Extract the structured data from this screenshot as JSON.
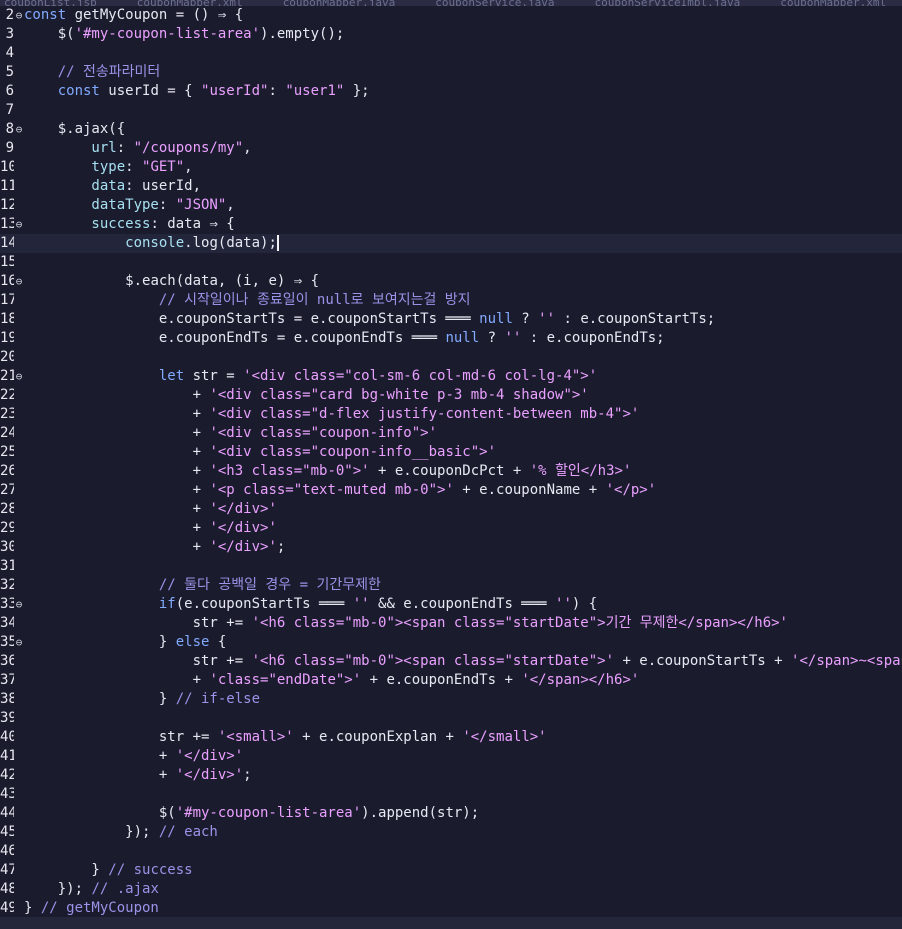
{
  "editor": {
    "tabs": [
      "couponList.jsp",
      "couponMapper.xml",
      "couponMapper.java",
      "couponService.java",
      "couponServiceImpl.java",
      "couponMapper.xml"
    ],
    "cursor_line": "14",
    "lines": [
      {
        "n": "2",
        "fold": "⊖",
        "tokens": [
          {
            "c": "kw",
            "t": "const "
          },
          {
            "c": "fn",
            "t": "getMyCoupon"
          },
          {
            "c": "op",
            "t": " = () ⇒ {"
          }
        ]
      },
      {
        "n": "3",
        "tokens": [
          {
            "c": "op",
            "t": "    $("
          },
          {
            "c": "str",
            "t": "'#my-coupon-list-area'"
          },
          {
            "c": "op",
            "t": ")."
          },
          {
            "c": "fn",
            "t": "empty"
          },
          {
            "c": "op",
            "t": "();"
          }
        ]
      },
      {
        "n": "4",
        "tokens": []
      },
      {
        "n": "5",
        "tokens": [
          {
            "c": "cmt",
            "t": "    // 전송파라미터"
          }
        ]
      },
      {
        "n": "6",
        "tokens": [
          {
            "c": "kw",
            "t": "    const "
          },
          {
            "c": "op",
            "t": "userId = { "
          },
          {
            "c": "str",
            "t": "\"userId\""
          },
          {
            "c": "op",
            "t": ": "
          },
          {
            "c": "str",
            "t": "\"user1\""
          },
          {
            "c": "op",
            "t": " };"
          }
        ]
      },
      {
        "n": "7",
        "tokens": []
      },
      {
        "n": "8",
        "fold": "⊖",
        "tokens": [
          {
            "c": "op",
            "t": "    $."
          },
          {
            "c": "fn",
            "t": "ajax"
          },
          {
            "c": "op",
            "t": "({"
          }
        ]
      },
      {
        "n": "9",
        "tokens": [
          {
            "c": "prop",
            "t": "        url"
          },
          {
            "c": "op",
            "t": ": "
          },
          {
            "c": "str",
            "t": "\"/coupons/my\""
          },
          {
            "c": "op",
            "t": ","
          }
        ]
      },
      {
        "n": "10",
        "tokens": [
          {
            "c": "prop",
            "t": "        type"
          },
          {
            "c": "op",
            "t": ": "
          },
          {
            "c": "str",
            "t": "\"GET\""
          },
          {
            "c": "op",
            "t": ","
          }
        ]
      },
      {
        "n": "11",
        "tokens": [
          {
            "c": "prop",
            "t": "        data"
          },
          {
            "c": "op",
            "t": ": userId,"
          }
        ]
      },
      {
        "n": "12",
        "tokens": [
          {
            "c": "prop",
            "t": "        dataType"
          },
          {
            "c": "op",
            "t": ": "
          },
          {
            "c": "str",
            "t": "\"JSON\""
          },
          {
            "c": "op",
            "t": ","
          }
        ]
      },
      {
        "n": "13",
        "fold": "⊖",
        "tokens": [
          {
            "c": "prop",
            "t": "        success"
          },
          {
            "c": "op",
            "t": ": data ⇒ {"
          }
        ]
      },
      {
        "n": "14",
        "current": true,
        "tokens": [
          {
            "c": "prop",
            "t": "            console"
          },
          {
            "c": "op",
            "t": "."
          },
          {
            "c": "fn",
            "t": "log"
          },
          {
            "c": "op",
            "t": "(data);"
          }
        ]
      },
      {
        "n": "15",
        "tokens": []
      },
      {
        "n": "16",
        "fold": "⊖",
        "tokens": [
          {
            "c": "op",
            "t": "            $."
          },
          {
            "c": "fn",
            "t": "each"
          },
          {
            "c": "op",
            "t": "(data, (i, e) ⇒ {"
          }
        ]
      },
      {
        "n": "17",
        "tokens": [
          {
            "c": "cmt",
            "t": "                // 시작일이나 종료일이 null로 보여지는걸 방지"
          }
        ]
      },
      {
        "n": "18",
        "tokens": [
          {
            "c": "op",
            "t": "                e.couponStartTs = e.couponStartTs ═══ "
          },
          {
            "c": "kw",
            "t": "null"
          },
          {
            "c": "op",
            "t": " ? "
          },
          {
            "c": "str",
            "t": "''"
          },
          {
            "c": "op",
            "t": " : e.couponStartTs;"
          }
        ]
      },
      {
        "n": "19",
        "tokens": [
          {
            "c": "op",
            "t": "                e.couponEndTs = e.couponEndTs ═══ "
          },
          {
            "c": "kw",
            "t": "null"
          },
          {
            "c": "op",
            "t": " ? "
          },
          {
            "c": "str",
            "t": "''"
          },
          {
            "c": "op",
            "t": " : e.couponEndTs;"
          }
        ]
      },
      {
        "n": "20",
        "tokens": []
      },
      {
        "n": "21",
        "fold": "⊖",
        "tokens": [
          {
            "c": "kw",
            "t": "                let "
          },
          {
            "c": "op",
            "t": "str = "
          },
          {
            "c": "str",
            "t": "'<div class=\"col-sm-6 col-md-6 col-lg-4\">'"
          }
        ]
      },
      {
        "n": "22",
        "tokens": [
          {
            "c": "op",
            "t": "                    + "
          },
          {
            "c": "str",
            "t": "'<div class=\"card bg-white p-3 mb-4 shadow\">'"
          }
        ]
      },
      {
        "n": "23",
        "tokens": [
          {
            "c": "op",
            "t": "                    + "
          },
          {
            "c": "str",
            "t": "'<div class=\"d-flex justify-content-between mb-4\">'"
          }
        ]
      },
      {
        "n": "24",
        "tokens": [
          {
            "c": "op",
            "t": "                    + "
          },
          {
            "c": "str",
            "t": "'<div class=\"coupon-info\">'"
          }
        ]
      },
      {
        "n": "25",
        "tokens": [
          {
            "c": "op",
            "t": "                    + "
          },
          {
            "c": "str",
            "t": "'<div class=\"coupon-info__basic\">'"
          }
        ]
      },
      {
        "n": "26",
        "tokens": [
          {
            "c": "op",
            "t": "                    + "
          },
          {
            "c": "str",
            "t": "'<h3 class=\"mb-0\">'"
          },
          {
            "c": "op",
            "t": " + e.couponDcPct + "
          },
          {
            "c": "str",
            "t": "'% 할인</h3>'"
          }
        ]
      },
      {
        "n": "27",
        "tokens": [
          {
            "c": "op",
            "t": "                    + "
          },
          {
            "c": "str",
            "t": "'<p class=\"text-muted mb-0\">'"
          },
          {
            "c": "op",
            "t": " + e.couponName + "
          },
          {
            "c": "str",
            "t": "'</p>'"
          }
        ]
      },
      {
        "n": "28",
        "tokens": [
          {
            "c": "op",
            "t": "                    + "
          },
          {
            "c": "str",
            "t": "'</div>'"
          }
        ]
      },
      {
        "n": "29",
        "tokens": [
          {
            "c": "op",
            "t": "                    + "
          },
          {
            "c": "str",
            "t": "'</div>'"
          }
        ]
      },
      {
        "n": "30",
        "tokens": [
          {
            "c": "op",
            "t": "                    + "
          },
          {
            "c": "str",
            "t": "'</div>'"
          },
          {
            "c": "op",
            "t": ";"
          }
        ]
      },
      {
        "n": "31",
        "tokens": []
      },
      {
        "n": "32",
        "tokens": [
          {
            "c": "cmt",
            "t": "                // 둘다 공백일 경우 = 기간무제한"
          }
        ]
      },
      {
        "n": "33",
        "fold": "⊖",
        "tokens": [
          {
            "c": "kw",
            "t": "                if"
          },
          {
            "c": "op",
            "t": "(e.couponStartTs ═══ "
          },
          {
            "c": "str",
            "t": "''"
          },
          {
            "c": "op",
            "t": " && e.couponEndTs ═══ "
          },
          {
            "c": "str",
            "t": "''"
          },
          {
            "c": "op",
            "t": ") {"
          }
        ]
      },
      {
        "n": "34",
        "tokens": [
          {
            "c": "op",
            "t": "                    str += "
          },
          {
            "c": "str",
            "t": "'<h6 class=\"mb-0\"><span class=\"startDate\">기간 무제한</span></h6>'"
          }
        ]
      },
      {
        "n": "35",
        "fold": "⊖",
        "tokens": [
          {
            "c": "op",
            "t": "                } "
          },
          {
            "c": "kw",
            "t": "else"
          },
          {
            "c": "op",
            "t": " {"
          }
        ]
      },
      {
        "n": "36",
        "tokens": [
          {
            "c": "op",
            "t": "                    str += "
          },
          {
            "c": "str",
            "t": "'<h6 class=\"mb-0\"><span class=\"startDate\">'"
          },
          {
            "c": "op",
            "t": " + e.couponStartTs + "
          },
          {
            "c": "str",
            "t": "'</span>~<span'"
          }
        ]
      },
      {
        "n": "37",
        "tokens": [
          {
            "c": "op",
            "t": "                    + "
          },
          {
            "c": "str",
            "t": "'class=\"endDate\">'"
          },
          {
            "c": "op",
            "t": " + e.couponEndTs + "
          },
          {
            "c": "str",
            "t": "'</span></h6>'"
          }
        ]
      },
      {
        "n": "38",
        "tokens": [
          {
            "c": "op",
            "t": "                } "
          },
          {
            "c": "cmt",
            "t": "// if-else"
          }
        ]
      },
      {
        "n": "39",
        "tokens": []
      },
      {
        "n": "40",
        "tokens": [
          {
            "c": "op",
            "t": "                str += "
          },
          {
            "c": "str",
            "t": "'<small>'"
          },
          {
            "c": "op",
            "t": " + e.couponExplan + "
          },
          {
            "c": "str",
            "t": "'</small>'"
          }
        ]
      },
      {
        "n": "41",
        "tokens": [
          {
            "c": "op",
            "t": "                + "
          },
          {
            "c": "str",
            "t": "'</div>'"
          }
        ]
      },
      {
        "n": "42",
        "tokens": [
          {
            "c": "op",
            "t": "                + "
          },
          {
            "c": "str",
            "t": "'</div>'"
          },
          {
            "c": "op",
            "t": ";"
          }
        ]
      },
      {
        "n": "43",
        "tokens": []
      },
      {
        "n": "44",
        "tokens": [
          {
            "c": "op",
            "t": "                $("
          },
          {
            "c": "str",
            "t": "'#my-coupon-list-area'"
          },
          {
            "c": "op",
            "t": ")."
          },
          {
            "c": "fn",
            "t": "append"
          },
          {
            "c": "op",
            "t": "(str);"
          }
        ]
      },
      {
        "n": "45",
        "tokens": [
          {
            "c": "op",
            "t": "            }); "
          },
          {
            "c": "cmt",
            "t": "// each"
          }
        ]
      },
      {
        "n": "46",
        "tokens": []
      },
      {
        "n": "47",
        "tokens": [
          {
            "c": "op",
            "t": "        } "
          },
          {
            "c": "cmt",
            "t": "// success"
          }
        ]
      },
      {
        "n": "48",
        "tokens": [
          {
            "c": "op",
            "t": "    }); "
          },
          {
            "c": "cmt",
            "t": "// .ajax"
          }
        ]
      },
      {
        "n": "49",
        "tokens": [
          {
            "c": "op",
            "t": "} "
          },
          {
            "c": "cmt",
            "t": "// getMyCoupon"
          }
        ]
      }
    ]
  }
}
